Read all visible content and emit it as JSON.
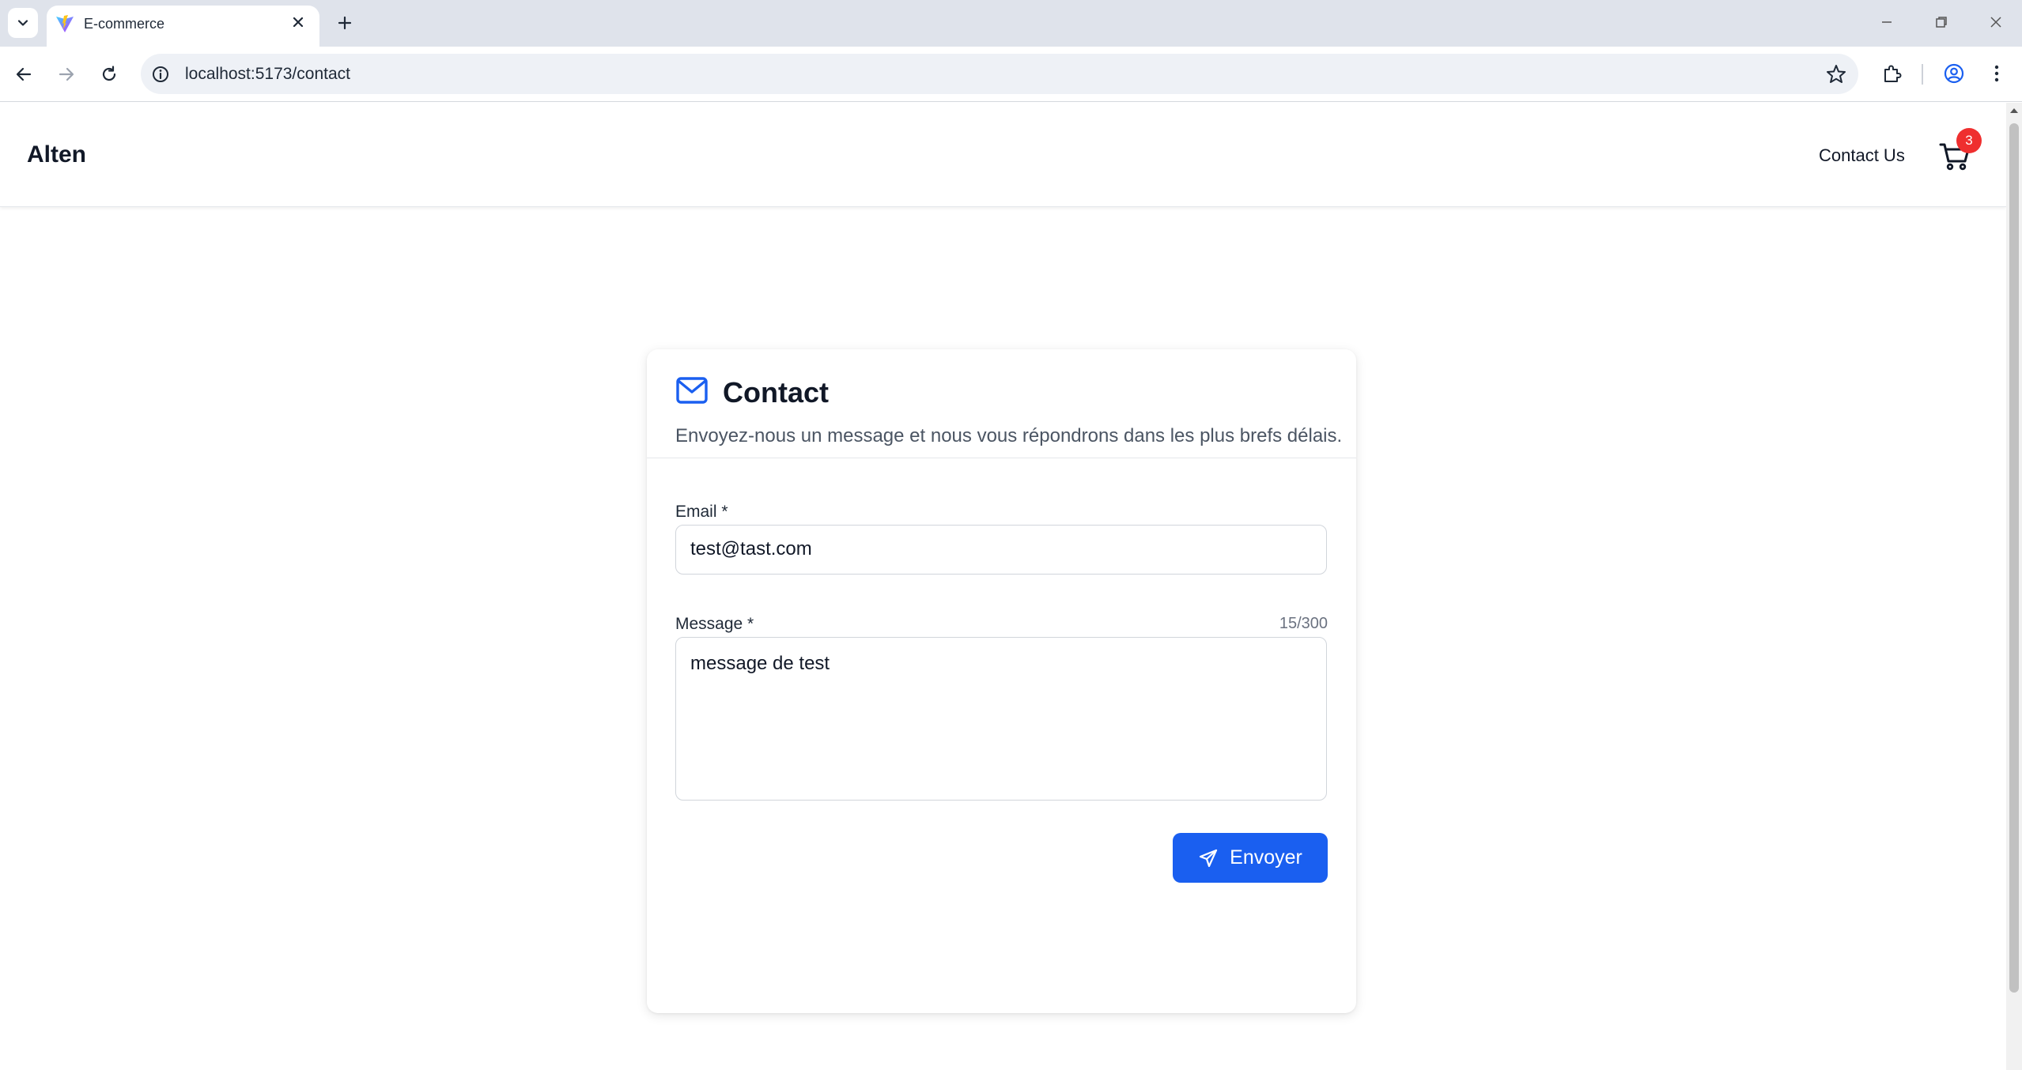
{
  "browser": {
    "tab_title": "E-commerce",
    "url": "localhost:5173/contact",
    "icons": {
      "tab_search": "chevron-down-icon",
      "tab_close": "close-icon",
      "new_tab": "plus-icon",
      "back": "arrow-left-icon",
      "forward": "arrow-right-icon",
      "reload": "reload-icon",
      "site_info": "info-icon",
      "bookmark": "star-icon",
      "extensions": "puzzle-icon",
      "profile": "profile-icon",
      "menu": "kebab-icon"
    }
  },
  "header": {
    "brand": "Alten",
    "nav_contact": "Contact Us",
    "cart_count": "3"
  },
  "contact": {
    "title": "Contact",
    "subtitle": "Envoyez-nous un message et nous vous répondrons dans les plus brefs délais.",
    "email_label": "Email *",
    "email_value": "test@tast.com",
    "message_label": "Message *",
    "message_counter": "15/300",
    "message_value": "message de test",
    "submit_label": "Envoyer"
  },
  "colors": {
    "accent": "#1a5ff0",
    "badge": "#ef2f2f",
    "chrome_bg": "#dfe3eb"
  }
}
